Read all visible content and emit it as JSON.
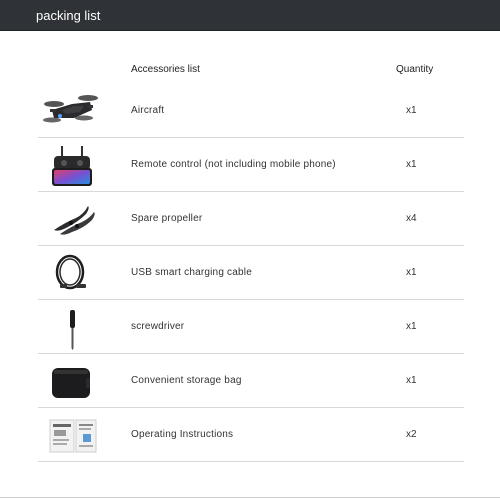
{
  "header": {
    "title": "packing list"
  },
  "columns": {
    "accessories": "Accessories list",
    "quantity": "Quantity"
  },
  "items": [
    {
      "label": "Aircraft",
      "qty": "x1",
      "icon": "drone-icon"
    },
    {
      "label": "Remote control (not including mobile phone)",
      "qty": "x1",
      "icon": "remote-control-icon"
    },
    {
      "label": "Spare propeller",
      "qty": "x4",
      "icon": "propeller-icon"
    },
    {
      "label": "USB smart charging cable",
      "qty": "x1",
      "icon": "usb-cable-icon"
    },
    {
      "label": "screwdriver",
      "qty": "x1",
      "icon": "screwdriver-icon"
    },
    {
      "label": "Convenient storage bag",
      "qty": "x1",
      "icon": "storage-bag-icon"
    },
    {
      "label": "Operating Instructions",
      "qty": "x2",
      "icon": "manual-icon"
    }
  ]
}
